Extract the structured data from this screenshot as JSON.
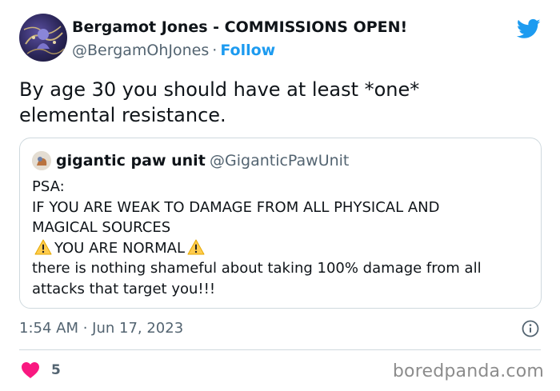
{
  "author": {
    "name": "Bergamot Jones - COMMISSIONS OPEN!",
    "handle": "@BergamOhJones",
    "separator": "·",
    "follow_label": "Follow"
  },
  "tweet": {
    "line1": "By age 30 you should have at least *one*",
    "line2": "elemental resistance."
  },
  "quoted": {
    "name": "gigantic paw unit",
    "handle": "@GiganticPawUnit",
    "lines": [
      "PSA:",
      "IF YOU ARE WEAK TO DAMAGE FROM ALL PHYSICAL AND",
      "MAGICAL SOURCES",
      "YOU ARE NORMAL",
      "there is nothing shameful about taking 100% damage from all",
      "attacks that target you!!!"
    ]
  },
  "timestamp": "1:54 AM · Jun 17, 2023",
  "likes": "5",
  "watermark": "boredpanda.com",
  "colors": {
    "accent": "#1d9bf0",
    "heart": "#f91880",
    "muted": "#536471",
    "warning": "#ffcc4d"
  },
  "icons": [
    "twitter-bird-icon",
    "info-icon",
    "heart-icon",
    "warning-icon"
  ]
}
